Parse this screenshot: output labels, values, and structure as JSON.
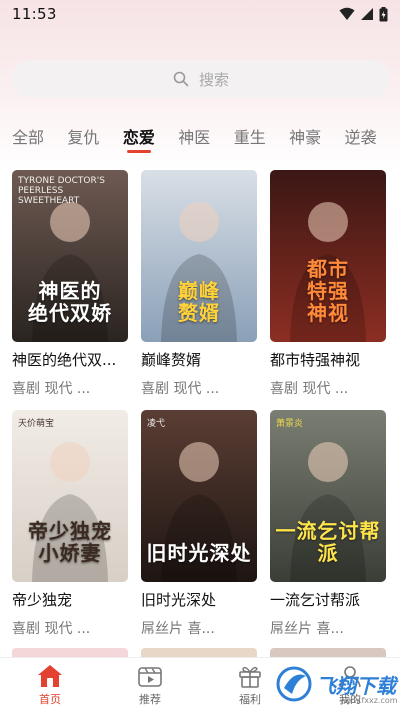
{
  "status_bar": {
    "time": "11:53"
  },
  "search": {
    "placeholder": "搜索"
  },
  "tabs": [
    {
      "label": "全部",
      "active": false
    },
    {
      "label": "复仇",
      "active": false
    },
    {
      "label": "恋爱",
      "active": true
    },
    {
      "label": "神医",
      "active": false
    },
    {
      "label": "重生",
      "active": false
    },
    {
      "label": "神豪",
      "active": false
    },
    {
      "label": "逆袭",
      "active": false
    }
  ],
  "cards": [
    {
      "title": "神医的绝代双...",
      "tags": "喜剧 现代 ...",
      "cover_text": "神医的\n绝代双娇",
      "cover_sub": "TYRONE DOCTOR'S PEERLESS SWEETHEART",
      "bg": [
        "#6e5a52",
        "#2a2420"
      ],
      "text_color": "#ffffff"
    },
    {
      "title": "巅峰赘婿",
      "tags": "喜剧 现代 ...",
      "cover_text": "巅峰\n赘婿",
      "cover_sub": "",
      "bg": [
        "#d9dfe6",
        "#8aa0b8"
      ],
      "text_color": "#ffd23a"
    },
    {
      "title": "都市特强神视",
      "tags": "喜剧 现代 ...",
      "cover_text": "都市\n特强\n神视",
      "cover_sub": "",
      "bg": [
        "#3b1714",
        "#8c2e22"
      ],
      "text_color": "#ff8a3a"
    },
    {
      "title": "帝少独宠",
      "tags": "喜剧 现代 ...",
      "cover_text": "帝少独宠\n小娇妻",
      "cover_sub": "天价萌宝",
      "bg": [
        "#f1ece6",
        "#d8cfc6"
      ],
      "text_color": "#3a2a22"
    },
    {
      "title": "旧时光深处",
      "tags": "屌丝片 喜...",
      "cover_text": "旧时光深处",
      "cover_sub": "凌弋",
      "bg": [
        "#5a3e34",
        "#1e1512"
      ],
      "text_color": "#ffffff"
    },
    {
      "title": "一流乞讨帮派",
      "tags": "屌丝片 喜...",
      "cover_text": "一流乞讨帮派",
      "cover_sub": "萧景炎",
      "bg": [
        "#7a7e72",
        "#3a3e36"
      ],
      "text_color": "#ffe44a"
    }
  ],
  "peek_colors": [
    "#f4d7d9",
    "#e8d6c6",
    "#d9c8c0"
  ],
  "bottom_nav": [
    {
      "label": "首页",
      "icon": "home-icon",
      "active": true
    },
    {
      "label": "推荐",
      "icon": "play-icon",
      "active": false
    },
    {
      "label": "福利",
      "icon": "gift-icon",
      "active": false
    },
    {
      "label": "我的",
      "icon": "user-icon",
      "active": false
    }
  ],
  "watermark": {
    "text": "飞翔下载",
    "sub": "www.fxxz.com"
  },
  "colors": {
    "accent": "#e2422f",
    "tab_inactive": "#777777"
  }
}
